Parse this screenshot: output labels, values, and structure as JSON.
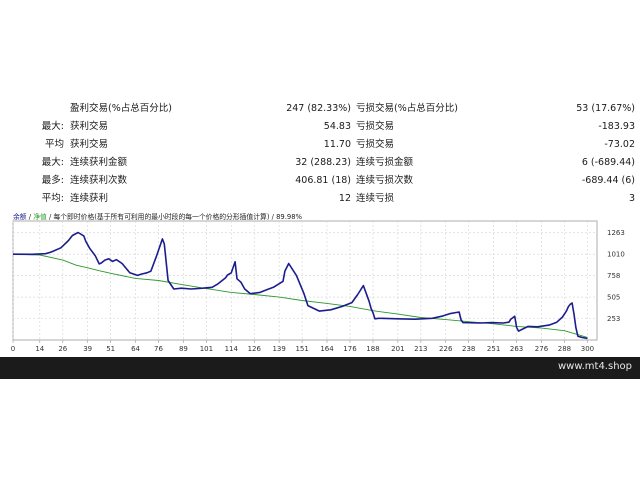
{
  "stats": {
    "rows": [
      {
        "c1": "",
        "c2": "盈利交易(%占总百分比)",
        "c3": "247 (82.33%)",
        "c4": "亏损交易(%占总百分比)",
        "c5": "53 (17.67%)"
      },
      {
        "c1": "最大:",
        "c2": "获利交易",
        "c3": "54.83",
        "c4": "亏损交易",
        "c5": "-183.93"
      },
      {
        "c1": "平均",
        "c2": "获利交易",
        "c3": "11.70",
        "c4": "亏损交易",
        "c5": "-73.02"
      },
      {
        "c1": "最大:",
        "c2": "连续获利金额",
        "c3": "32 (288.23)",
        "c4": "连续亏损金额",
        "c5": "6 (-689.44)"
      },
      {
        "c1": "最多:",
        "c2": "连续获利次数",
        "c3": "406.81 (18)",
        "c4": "连续亏损次数",
        "c5": "-689.44 (6)"
      },
      {
        "c1": "平均:",
        "c2": "连续获利",
        "c3": "12",
        "c4": "连续亏损",
        "c5": "3"
      }
    ]
  },
  "chart_legend": {
    "balance_label": "余额",
    "sep1": "/",
    "equity_label": "净值",
    "sep2": "/",
    "description": "每个即时价格(基于所有可利用的最小时段的每一个价格的分形插值计算) / 89.98%"
  },
  "chart_data": {
    "type": "line",
    "xlabel": "",
    "ylabel": "",
    "xlim": [
      0,
      305
    ],
    "ylim": [
      0,
      1400
    ],
    "x_ticks": [
      0,
      14,
      26,
      39,
      51,
      64,
      76,
      89,
      101,
      114,
      126,
      139,
      151,
      164,
      176,
      188,
      201,
      213,
      226,
      238,
      251,
      263,
      276,
      288,
      300
    ],
    "y_ticks": [
      253,
      505,
      758,
      1010,
      1263
    ],
    "colors": {
      "balance": "#2c9a2c",
      "equity": "#1c1c8e",
      "grid": "#d3d3d3",
      "axis": "#9a9a9a"
    },
    "series": [
      {
        "name": "余额",
        "x": [
          0,
          14,
          26,
          33,
          39,
          45,
          51,
          64,
          76,
          89,
          101,
          114,
          126,
          139,
          151,
          164,
          176,
          188,
          201,
          213,
          226,
          238,
          251,
          263,
          276,
          288,
          300
        ],
        "y": [
          1010,
          1000,
          940,
          880,
          850,
          815,
          785,
          725,
          700,
          650,
          605,
          560,
          535,
          505,
          465,
          430,
          395,
          345,
          305,
          265,
          240,
          215,
          190,
          160,
          140,
          110,
          30
        ]
      },
      {
        "name": "净值",
        "x": [
          0,
          10,
          17,
          20,
          25,
          29,
          31,
          34,
          37,
          38,
          40,
          43,
          45,
          46,
          48,
          50,
          52,
          54,
          57,
          61,
          65,
          67,
          70,
          72,
          73,
          75,
          78,
          79,
          81,
          84,
          88,
          93,
          99,
          104,
          107,
          111,
          112,
          114,
          115,
          116,
          117,
          119,
          121,
          124,
          129,
          133,
          136,
          141,
          142,
          144,
          148,
          152,
          154,
          160,
          166,
          172,
          177,
          180,
          183,
          186,
          187,
          188,
          189,
          191,
          201,
          210,
          219,
          224,
          228,
          233,
          234,
          235,
          244,
          250,
          256,
          259,
          260,
          262,
          263,
          264,
          269,
          274,
          280,
          284,
          287,
          289,
          290,
          291,
          292,
          293,
          294,
          295,
          297,
          299,
          300
        ],
        "y": [
          1010,
          1008,
          1015,
          1035,
          1085,
          1170,
          1230,
          1265,
          1225,
          1160,
          1080,
          990,
          895,
          905,
          940,
          955,
          925,
          945,
          900,
          790,
          760,
          775,
          790,
          810,
          870,
          990,
          1190,
          1130,
          700,
          600,
          610,
          600,
          610,
          620,
          660,
          730,
          765,
          790,
          855,
          920,
          720,
          680,
          600,
          545,
          560,
          595,
          620,
          690,
          810,
          900,
          760,
          545,
          405,
          340,
          355,
          395,
          440,
          535,
          640,
          455,
          370,
          320,
          250,
          255,
          250,
          245,
          255,
          280,
          310,
          330,
          235,
          205,
          200,
          205,
          200,
          210,
          245,
          280,
          150,
          105,
          160,
          155,
          175,
          210,
          270,
          340,
          390,
          420,
          435,
          305,
          145,
          45,
          30,
          22,
          18
        ]
      }
    ]
  },
  "footer": {
    "site": "www.mt4.shop"
  }
}
